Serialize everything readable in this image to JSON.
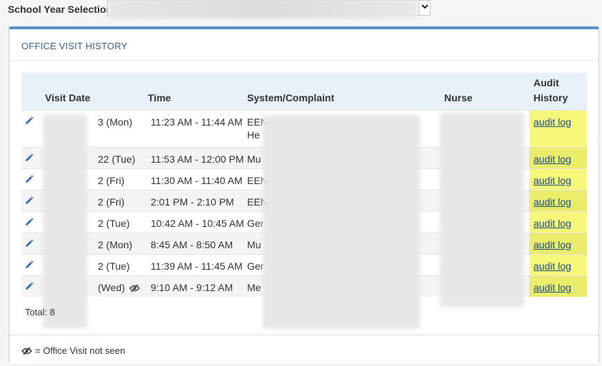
{
  "school_year": {
    "label": "School Year Selection:",
    "selected": ""
  },
  "panel": {
    "title": "OFFICE VISIT HISTORY"
  },
  "table": {
    "headers": {
      "visit_date": "Visit Date",
      "time": "Time",
      "system": "System/Complaint",
      "nurse": "Nurse",
      "audit": "Audit History"
    },
    "rows": [
      {
        "date": "3 (Mon)",
        "time": "11:23 AM - 11:44 AM",
        "system": "EEN",
        "system2": "He",
        "audit": "audit log",
        "unseen": false
      },
      {
        "date": "22 (Tue)",
        "time": "11:53 AM - 12:00 PM",
        "system": "Mu",
        "audit": "audit log",
        "unseen": false
      },
      {
        "date": "2 (Fri)",
        "time": "11:30 AM - 11:40 AM",
        "system": "EEN",
        "audit": "audit log",
        "unseen": false
      },
      {
        "date": "2 (Fri)",
        "time": "2:01 PM - 2:10 PM",
        "system": "EEN",
        "audit": "audit log",
        "unseen": false
      },
      {
        "date": "2 (Tue)",
        "time": "10:42 AM - 10:45 AM",
        "system": "Ger",
        "audit": "audit log",
        "unseen": false
      },
      {
        "date": "2 (Mon)",
        "time": "8:45 AM - 8:50 AM",
        "system": "Mu",
        "audit": "audit log",
        "unseen": false
      },
      {
        "date": "2 (Tue)",
        "time": "11:39 AM - 11:45 AM",
        "system": "Ger",
        "audit": "audit log",
        "unseen": false
      },
      {
        "date": "(Wed)",
        "time": "9:10 AM - 9:12 AM",
        "system": "Me",
        "audit": "audit log",
        "unseen": true
      }
    ]
  },
  "total": "Total: 8",
  "legend": "= Office Visit not seen",
  "icons": {
    "edit": "pencil-icon",
    "unseen": "eye-slash-icon"
  },
  "colors": {
    "accent": "#5b8fc7",
    "header_bg": "#e8f1fa",
    "highlight": "#f7f77a",
    "link": "#1a4c8a"
  }
}
